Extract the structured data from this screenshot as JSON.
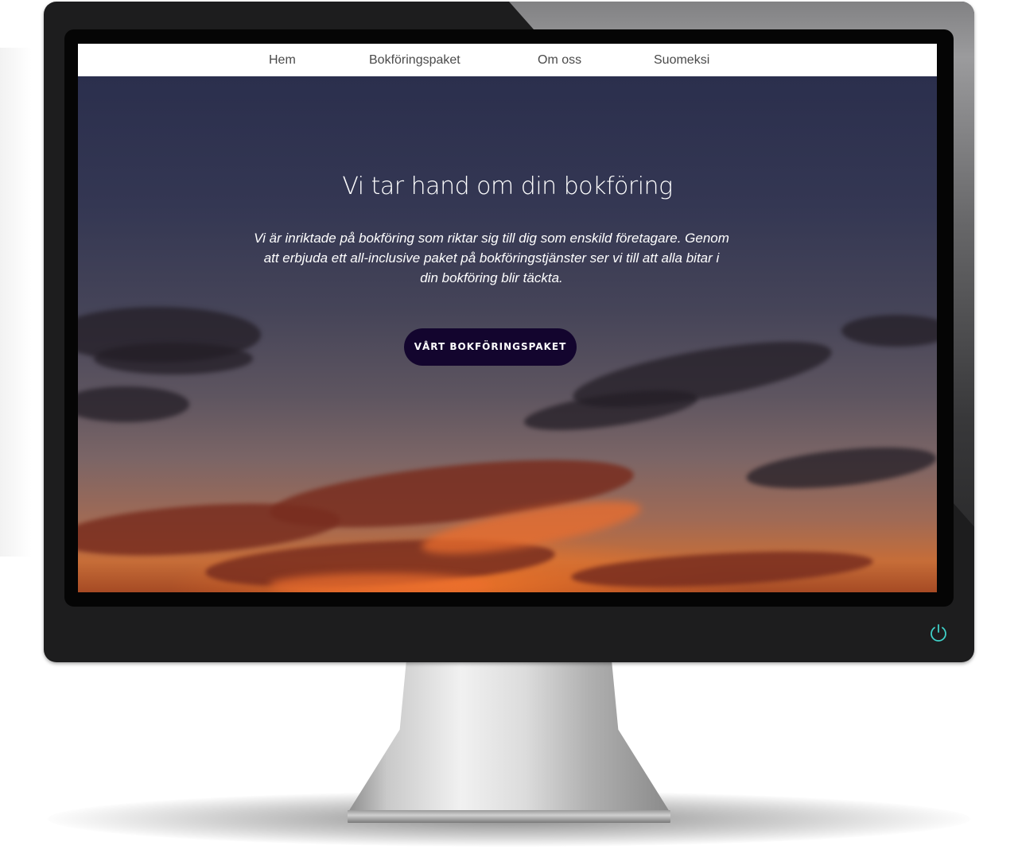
{
  "nav": {
    "items": [
      {
        "label": "Hem"
      },
      {
        "label": "Bokföringspaket"
      },
      {
        "label": "Om oss"
      },
      {
        "label": "Suomeksi"
      }
    ]
  },
  "hero": {
    "title": "Vi tar hand om din bokföring",
    "line1": "Vi är inriktade på bokföring som riktar sig till dig som enskild företagare. Genom",
    "line2": "att erbjuda ett all-inclusive paket på bokföringstjänster ser vi till att alla bitar i",
    "line3": "din bokföring blir täckta.",
    "cta_label": "VÅRT BOKFÖRINGSPAKET"
  },
  "colors": {
    "cta_background": "#13052e",
    "power_icon": "#3fd0c8",
    "monitor_frame": "#1d1d1e"
  },
  "icons": {
    "power": "power-icon"
  }
}
